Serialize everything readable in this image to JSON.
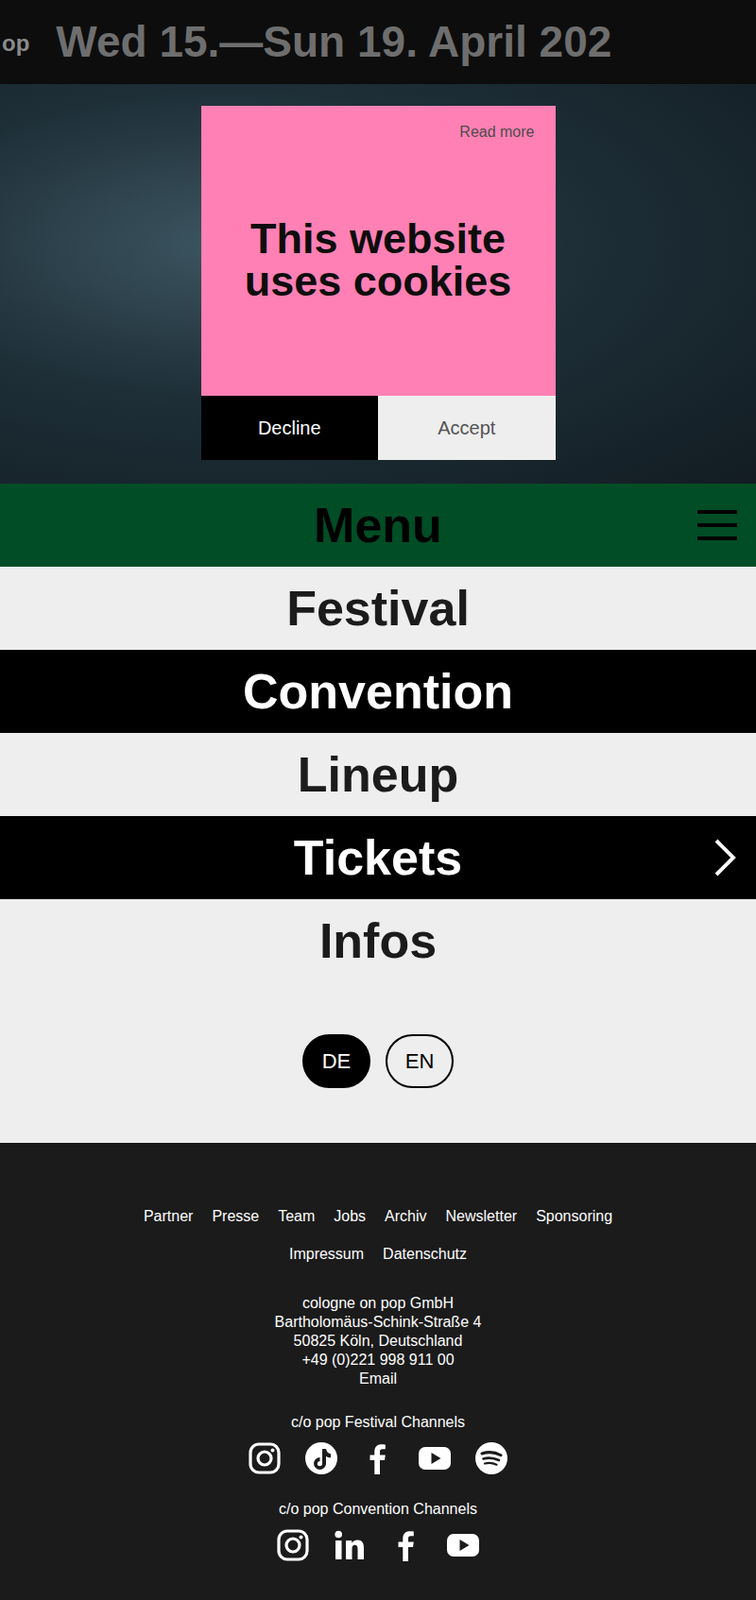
{
  "ticker": [
    "op",
    "Wed 15.—Sun 19. April 202"
  ],
  "cookie_banner": {
    "link": "Read more",
    "title": "This website uses cookies",
    "buttons": [
      "Decline",
      "Accept"
    ]
  },
  "menu": {
    "title": "Menu",
    "items": [
      {
        "label": "Festival",
        "expandable": false
      },
      {
        "label": "Convention",
        "expandable": false
      },
      {
        "label": "Lineup",
        "expandable": false
      },
      {
        "label": "Tickets",
        "expandable": true
      },
      {
        "label": "Infos",
        "expandable": false
      }
    ]
  },
  "languages": [
    {
      "label": "DE",
      "selected": true
    },
    {
      "label": "EN",
      "selected": false
    }
  ],
  "footer": {
    "links": [
      "Partner",
      "Presse",
      "Team",
      "Jobs",
      "Archiv",
      "Newsletter",
      "Sponsoring"
    ],
    "legal_links": [
      "Impressum",
      "Datenschutz"
    ],
    "address": [
      "cologne on pop GmbH",
      "Bartholomäus-Schink-Straße 4",
      "50825 Köln, Deutschland",
      "+49 (0)221 998 911 00",
      "Email"
    ],
    "channel_groups": [
      {
        "title": "c/o pop Festival Channels",
        "channels": [
          {
            "kind": "instagram"
          },
          {
            "kind": "tiktok"
          },
          {
            "kind": "facebook"
          },
          {
            "kind": "youtube"
          },
          {
            "kind": "spotify"
          }
        ]
      },
      {
        "title": "c/o pop Convention Channels",
        "channels": [
          {
            "kind": "instagram"
          },
          {
            "kind": "linkedin"
          },
          {
            "kind": "facebook"
          },
          {
            "kind": "youtube"
          }
        ]
      }
    ]
  }
}
